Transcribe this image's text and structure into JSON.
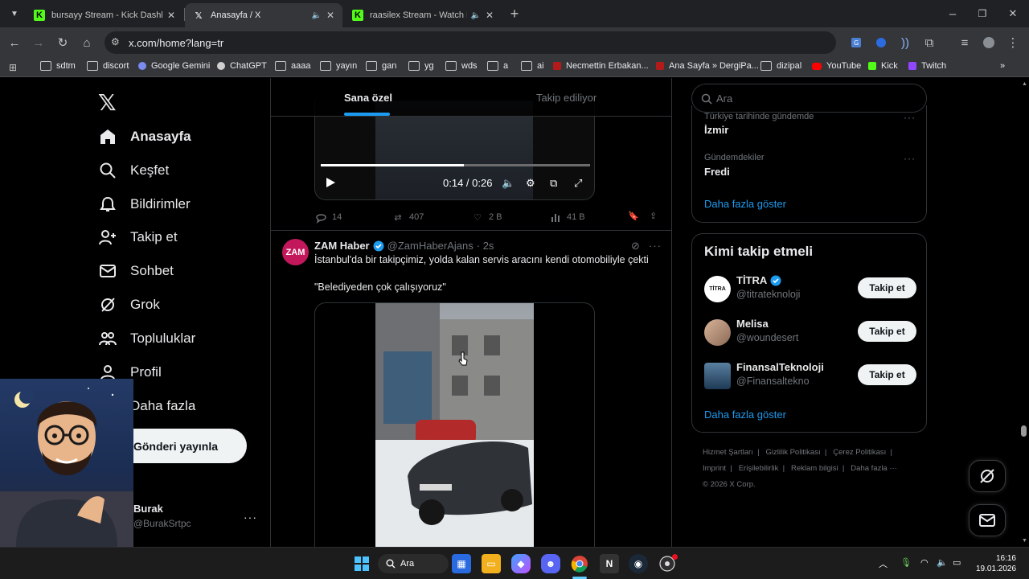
{
  "browser": {
    "tabs": [
      {
        "title": "bursayy Stream - Kick Dashboard",
        "icon": "kick-icon"
      },
      {
        "title": "Anasayfa / X",
        "icon": "x-logo-icon",
        "audio": true
      },
      {
        "title": "raasilex Stream - Watch Live",
        "icon": "kick-icon",
        "audio": true
      }
    ],
    "url": "x.com/home?lang=tr",
    "bookmarks": [
      "sdtm",
      "discort",
      "Google Gemini",
      "ChatGPT",
      "aaaa",
      "yayın",
      "gan",
      "yg",
      "wds",
      "a",
      "ai",
      "Necmettin Erbakan...",
      "Ana Sayfa » DergiPa...",
      "dizipal",
      "YouTube",
      "Kick",
      "Twitch"
    ]
  },
  "sidebar": {
    "items": [
      {
        "label": "Anasayfa",
        "icon": "home-icon"
      },
      {
        "label": "Keşfet",
        "icon": "search-icon"
      },
      {
        "label": "Bildirimler",
        "icon": "bell-icon"
      },
      {
        "label": "Takip et",
        "icon": "follow-icon"
      },
      {
        "label": "Sohbet",
        "icon": "mail-icon"
      },
      {
        "label": "Grok",
        "icon": "grok-icon"
      },
      {
        "label": "Topluluklar",
        "icon": "communities-icon"
      },
      {
        "label": "Profil",
        "icon": "profile-icon"
      },
      {
        "label": "Daha fazla",
        "icon": "more-icon"
      }
    ],
    "post_button": "Gönderi yayınla",
    "user": {
      "name": "Burak",
      "handle": "@BurakSrtpc"
    }
  },
  "timeline": {
    "tabs": [
      "Sana özel",
      "Takip ediliyor"
    ],
    "video1": {
      "time": "0:14 / 0:26",
      "progress": 0.53
    },
    "actions1": {
      "replies": "14",
      "reposts": "407",
      "likes": "2 B",
      "views": "41 B"
    },
    "tweet2": {
      "avatar_text": "ZAM",
      "name": "ZAM Haber",
      "handle": "@ZamHaberAjans",
      "time": "· 2s",
      "text": "İstanbul'da bir takipçimiz, yolda kalan servis aracını kendi otomobiliyle çekti",
      "quote": "\"Belediyeden çok çalışıyoruz\""
    }
  },
  "right": {
    "search_placeholder": "Ara",
    "trends": [
      {
        "meta": "Türkiye tarihinde gündemde",
        "name": "İzmir"
      },
      {
        "meta": "Gündemdekiler",
        "name": "Fredi"
      }
    ],
    "show_more": "Daha fazla göster",
    "who_title": "Kimi takip etmeli",
    "who": [
      {
        "name": "TİTRA",
        "handle": "@titrateknoloji",
        "verified": true,
        "avatar_text": "TİTRA"
      },
      {
        "name": "Melisa",
        "handle": "@woundesert",
        "verified": false,
        "avatar_text": ""
      },
      {
        "name": "FinansalTeknoloji",
        "handle": "@Finansaltekno",
        "verified": false,
        "avatar_text": ""
      }
    ],
    "follow_label": "Takip et",
    "footer": [
      "Hizmet Şartları",
      "Gizlilik Politikası",
      "Çerez Politikası",
      "Imprint",
      "Erişilebilirlik",
      "Reklam bilgisi",
      "Daha fazla ···",
      "© 2026 X Corp."
    ]
  },
  "taskbar": {
    "search_label": "Ara",
    "time": "16:16",
    "date": "19.01.2026"
  },
  "colors": {
    "accent": "#1d9bf0",
    "background": "#000000",
    "kick": "#53fc18"
  }
}
